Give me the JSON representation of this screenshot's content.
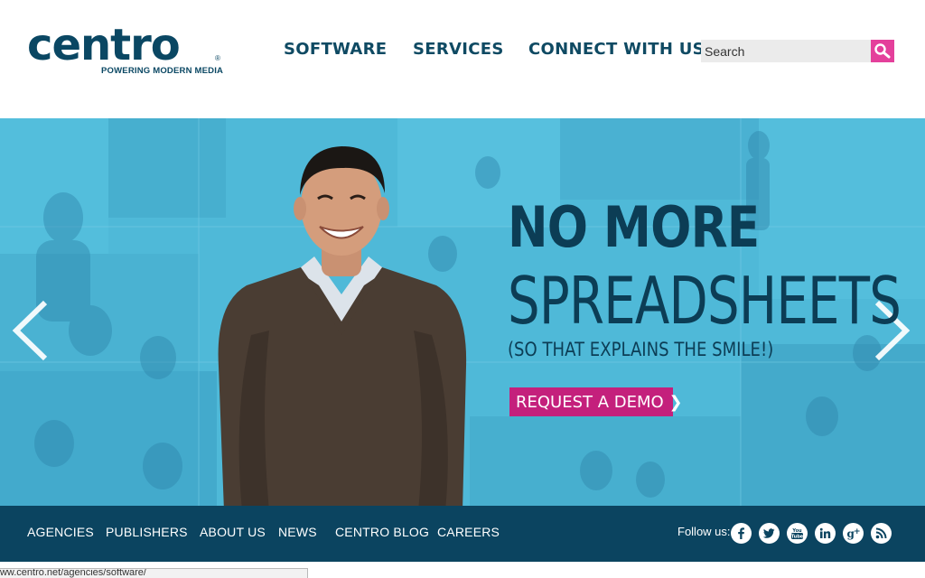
{
  "header": {
    "logo": {
      "word": "centro",
      "tagline": "POWERING MODERN MEDIA",
      "reg": "®"
    },
    "nav": [
      {
        "label": "SOFTWARE"
      },
      {
        "label": "SERVICES"
      },
      {
        "label": "CONNECT WITH US"
      }
    ],
    "search": {
      "placeholder": "Search",
      "button_icon": "magnifier-icon"
    }
  },
  "hero": {
    "headline_1": "NO MORE",
    "headline_2": "SPREADSHEETS",
    "subline": "(SO THAT EXPLAINS THE SMILE!)",
    "cta_label": "REQUEST A DEMO",
    "cta_icon": "❯",
    "prev_icon": "chevron-left-icon",
    "next_icon": "chevron-right-icon"
  },
  "footer": {
    "links": [
      {
        "label": "AGENCIES"
      },
      {
        "label": "PUBLISHERS"
      },
      {
        "label": "ABOUT US"
      },
      {
        "label": "NEWS"
      },
      {
        "label": "CENTRO BLOG"
      },
      {
        "label": "CAREERS"
      }
    ],
    "follow_label": "Follow us:",
    "social": [
      "facebook-icon",
      "twitter-icon",
      "youtube-icon",
      "linkedin-icon",
      "google-plus-icon",
      "rss-icon"
    ]
  },
  "status_bar": {
    "url": "www.centro.net/agencies/software/"
  },
  "colors": {
    "brand_navy": "#0b4460",
    "hero_cyan": "#4fb9d8",
    "accent_magenta": "#c4207c",
    "search_pink": "#e4409b"
  }
}
